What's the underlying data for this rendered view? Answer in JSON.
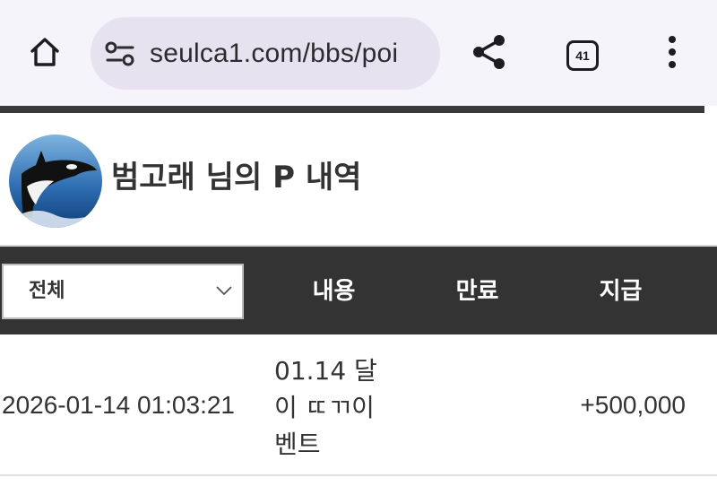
{
  "browser": {
    "url": "seulca1.com/bbs/poi",
    "tab_count": "41",
    "icons": {
      "home": "home-icon",
      "site_settings": "site-settings-icon",
      "share": "share-icon",
      "tabs": "tabs-icon",
      "menu": "more-vert-icon"
    }
  },
  "profile": {
    "title": "범고래 님의 P 내역",
    "avatar": "orca-avatar"
  },
  "table": {
    "filter": {
      "selected": "전체"
    },
    "headers": {
      "content": "내용",
      "expire": "만료",
      "grant": "지급"
    },
    "rows": [
      {
        "date": "2026-01-14 01:03:21",
        "content": "01.14 달이 ㄸㄲ이벤트",
        "expire": "",
        "amount": "+500,000"
      }
    ]
  },
  "colors": {
    "header_bar": "#333333",
    "chrome_bg": "#f6f4fb",
    "urlbar_bg": "#e6e2ef"
  }
}
